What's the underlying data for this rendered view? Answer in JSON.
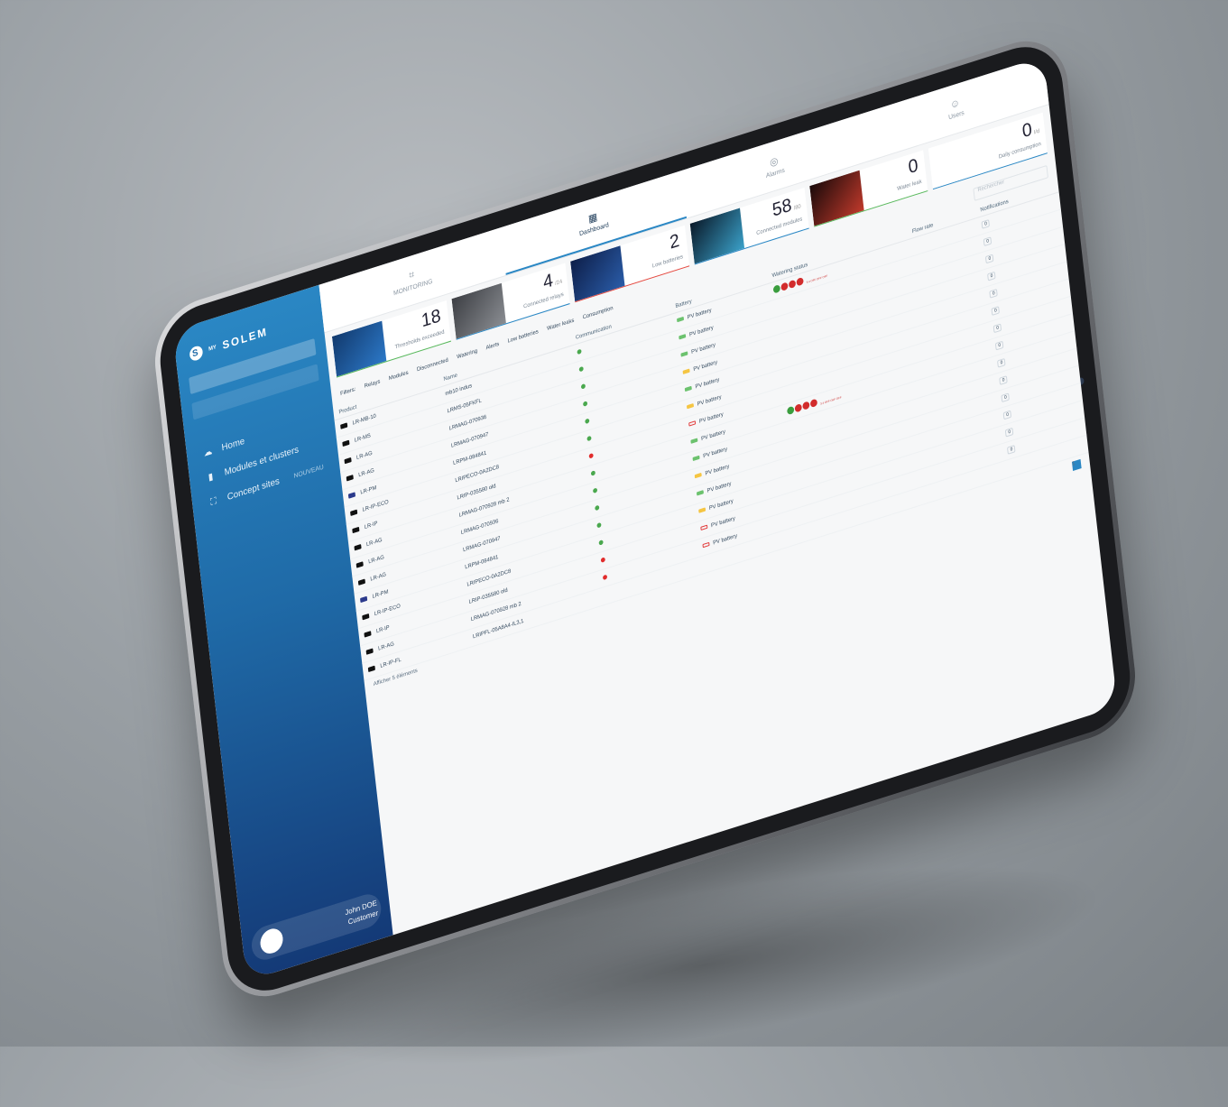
{
  "brand": {
    "name": "SOLEM",
    "prefix": "MY"
  },
  "sidebar": {
    "nav": [
      {
        "label": "Home",
        "icon": "cloud-icon"
      },
      {
        "label": "Modules et clusters",
        "icon": "module-icon"
      },
      {
        "label": "Concept sites",
        "icon": "site-icon",
        "extra": "NOUVEAU"
      }
    ],
    "user": {
      "name": "John DOE",
      "role": "Customer"
    }
  },
  "tabs": [
    {
      "label": "MONITORING",
      "icon": "monitor-icon"
    },
    {
      "label": "Dashboard",
      "icon": "dashboard-icon"
    },
    {
      "label": "Alarms",
      "icon": "alarm-icon"
    },
    {
      "label": "Users",
      "icon": "user-icon"
    }
  ],
  "kpis": [
    {
      "value": "18",
      "unit": "",
      "label": "Thresholds exceeded",
      "accent": "green"
    },
    {
      "value": "4",
      "unit": "/24",
      "label": "Connected relays",
      "accent": "blue"
    },
    {
      "value": "2",
      "unit": "",
      "label": "Low batteries",
      "accent": "red"
    },
    {
      "value": "58",
      "unit": "/80",
      "label": "Connected modules",
      "accent": "blue"
    },
    {
      "value": "0",
      "unit": "",
      "label": "Water leak",
      "accent": "green"
    },
    {
      "value": "0",
      "unit": "l/d",
      "label": "Daily consumption",
      "accent": "blue"
    }
  ],
  "filters": [
    "Filters:",
    "Relays",
    "Modules",
    "Disconnected",
    "Watering",
    "Alerts",
    "Low batteries",
    "Water leaks",
    "Consumption"
  ],
  "search_placeholder": "Rechercher",
  "columns": [
    "Product",
    "Name",
    "Communication",
    "Battery",
    "Watering status",
    "Flow rate",
    "Notifications"
  ],
  "rows": [
    {
      "product": "LR-MB-10",
      "name": "mb10 indus",
      "comm": "ok",
      "battery": "full",
      "label": "PV battery",
      "valves": "3 4 OFF OFF OFF",
      "notif": "0"
    },
    {
      "product": "LR-MS",
      "name": "LRMS-05FKFL",
      "comm": "ok",
      "battery": "full",
      "label": "PV battery",
      "valves": "",
      "notif": "0"
    },
    {
      "product": "LR-AG",
      "name": "LRMAG-070936",
      "comm": "ok",
      "battery": "full",
      "label": "PV battery",
      "valves": "",
      "notif": "0"
    },
    {
      "product": "LR-AG",
      "name": "LRMAG-070947",
      "comm": "ok",
      "battery": "half",
      "label": "PV battery",
      "valves": "",
      "notif": "0"
    },
    {
      "product": "LR-PM",
      "name": "LRPM-084841",
      "comm": "ok",
      "battery": "full",
      "label": "PV battery",
      "valves": "",
      "notif": "0"
    },
    {
      "product": "LR-IP-ECO",
      "name": "LRIPECO-0A2DC8",
      "comm": "ok",
      "battery": "half",
      "label": "PV battery",
      "valves": "",
      "notif": "0"
    },
    {
      "product": "LR-IP",
      "name": "LRIP-035580 old",
      "comm": "bad",
      "battery": "empty",
      "label": "PV battery",
      "valves": "",
      "notif": "0"
    },
    {
      "product": "LR-AG",
      "name": "LRMAG-070928 mb 2",
      "comm": "ok",
      "battery": "full",
      "label": "PV battery",
      "valves": "3 4 OFF OFF OFF",
      "notif": "0"
    },
    {
      "product": "LR-AG",
      "name": "LRMAG-070936",
      "comm": "ok",
      "battery": "full",
      "label": "PV battery",
      "valves": "",
      "notif": "0"
    },
    {
      "product": "LR-AG",
      "name": "LRMAG-070947",
      "comm": "ok",
      "battery": "half",
      "label": "PV battery",
      "valves": "",
      "notif": "0"
    },
    {
      "product": "LR-PM",
      "name": "LRPM-084841",
      "comm": "ok",
      "battery": "full",
      "label": "PV battery",
      "valves": "",
      "notif": "0"
    },
    {
      "product": "LR-IP-ECO",
      "name": "LRIPECO-0A2DC8",
      "comm": "ok",
      "battery": "half",
      "label": "PV battery",
      "valves": "",
      "notif": "0"
    },
    {
      "product": "LR-IP",
      "name": "LRIP-035580 old",
      "comm": "bad",
      "battery": "empty",
      "label": "PV battery",
      "valves": "",
      "notif": "0"
    },
    {
      "product": "LR-AG",
      "name": "LRMAG-070928 mb 2",
      "comm": "bad",
      "battery": "empty",
      "label": "PV battery",
      "valves": "",
      "notif": "0"
    },
    {
      "product": "LR-IP-FL",
      "name": "LRIPFL-05A8A4-IL3,1",
      "comm": "",
      "battery": "",
      "label": "",
      "valves": "",
      "notif": ""
    }
  ],
  "pager": {
    "show_label": "Afficher",
    "per_page": "5",
    "elements_label": "éléments",
    "current_page": "1"
  }
}
